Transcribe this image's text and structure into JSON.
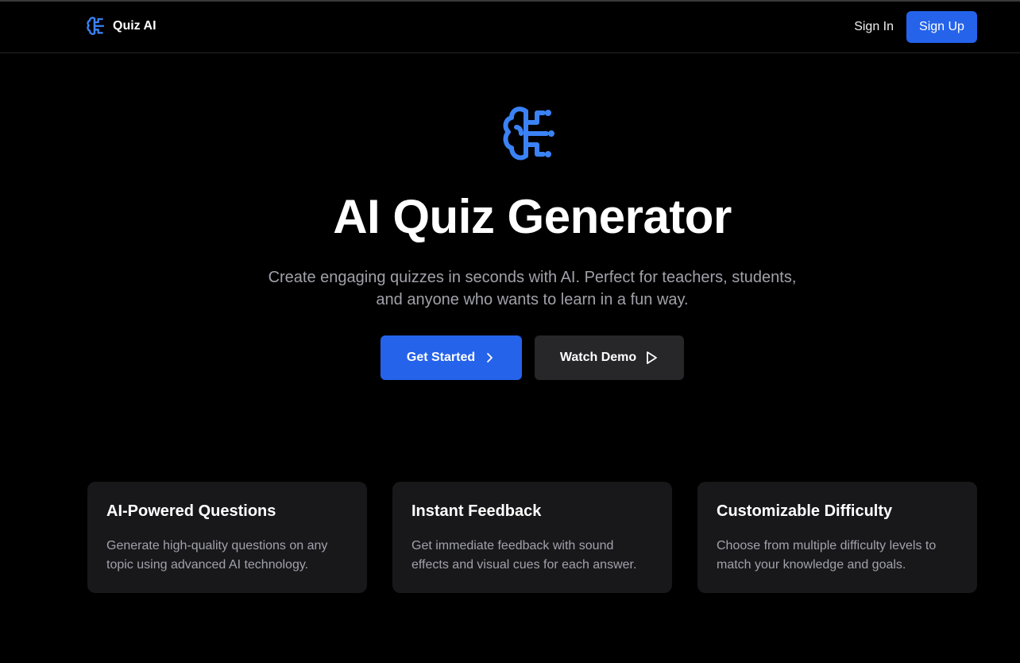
{
  "nav": {
    "brand": "Quiz AI",
    "sign_in": "Sign In",
    "sign_up": "Sign Up",
    "brand_icon": "brain-circuit-icon"
  },
  "hero": {
    "icon": "brain-circuit-icon",
    "title": "AI Quiz Generator",
    "subtitle": "Create engaging quizzes in seconds with AI. Perfect for teachers, students, and anyone who wants to learn in a fun way.",
    "primary_cta": "Get Started",
    "primary_cta_icon": "chevron-right-icon",
    "secondary_cta": "Watch Demo",
    "secondary_cta_icon": "play-icon"
  },
  "features": [
    {
      "title": "AI-Powered Questions",
      "description": "Generate high-quality questions on any topic using advanced AI technology."
    },
    {
      "title": "Instant Feedback",
      "description": "Get immediate feedback with sound effects and visual cues for each answer."
    },
    {
      "title": "Customizable Difficulty",
      "description": "Choose from multiple difficulty levels to match your knowledge and goals."
    }
  ],
  "colors": {
    "accent": "#2563eb",
    "background": "#000000",
    "card": "#18181b",
    "muted_text": "#a1a1aa",
    "secondary_button": "#27272a"
  }
}
